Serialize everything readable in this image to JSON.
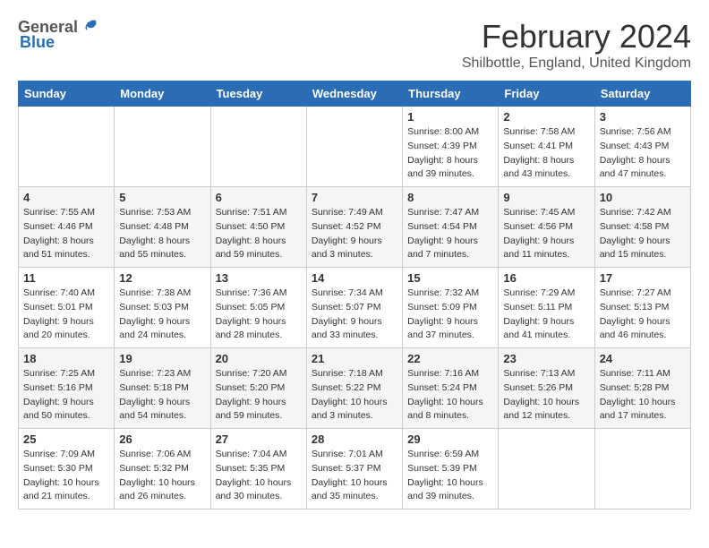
{
  "header": {
    "logo_general": "General",
    "logo_blue": "Blue",
    "month_year": "February 2024",
    "location": "Shilbottle, England, United Kingdom"
  },
  "weekdays": [
    "Sunday",
    "Monday",
    "Tuesday",
    "Wednesday",
    "Thursday",
    "Friday",
    "Saturday"
  ],
  "weeks": [
    [
      {
        "day": "",
        "info": ""
      },
      {
        "day": "",
        "info": ""
      },
      {
        "day": "",
        "info": ""
      },
      {
        "day": "",
        "info": ""
      },
      {
        "day": "1",
        "info": "Sunrise: 8:00 AM\nSunset: 4:39 PM\nDaylight: 8 hours\nand 39 minutes."
      },
      {
        "day": "2",
        "info": "Sunrise: 7:58 AM\nSunset: 4:41 PM\nDaylight: 8 hours\nand 43 minutes."
      },
      {
        "day": "3",
        "info": "Sunrise: 7:56 AM\nSunset: 4:43 PM\nDaylight: 8 hours\nand 47 minutes."
      }
    ],
    [
      {
        "day": "4",
        "info": "Sunrise: 7:55 AM\nSunset: 4:46 PM\nDaylight: 8 hours\nand 51 minutes."
      },
      {
        "day": "5",
        "info": "Sunrise: 7:53 AM\nSunset: 4:48 PM\nDaylight: 8 hours\nand 55 minutes."
      },
      {
        "day": "6",
        "info": "Sunrise: 7:51 AM\nSunset: 4:50 PM\nDaylight: 8 hours\nand 59 minutes."
      },
      {
        "day": "7",
        "info": "Sunrise: 7:49 AM\nSunset: 4:52 PM\nDaylight: 9 hours\nand 3 minutes."
      },
      {
        "day": "8",
        "info": "Sunrise: 7:47 AM\nSunset: 4:54 PM\nDaylight: 9 hours\nand 7 minutes."
      },
      {
        "day": "9",
        "info": "Sunrise: 7:45 AM\nSunset: 4:56 PM\nDaylight: 9 hours\nand 11 minutes."
      },
      {
        "day": "10",
        "info": "Sunrise: 7:42 AM\nSunset: 4:58 PM\nDaylight: 9 hours\nand 15 minutes."
      }
    ],
    [
      {
        "day": "11",
        "info": "Sunrise: 7:40 AM\nSunset: 5:01 PM\nDaylight: 9 hours\nand 20 minutes."
      },
      {
        "day": "12",
        "info": "Sunrise: 7:38 AM\nSunset: 5:03 PM\nDaylight: 9 hours\nand 24 minutes."
      },
      {
        "day": "13",
        "info": "Sunrise: 7:36 AM\nSunset: 5:05 PM\nDaylight: 9 hours\nand 28 minutes."
      },
      {
        "day": "14",
        "info": "Sunrise: 7:34 AM\nSunset: 5:07 PM\nDaylight: 9 hours\nand 33 minutes."
      },
      {
        "day": "15",
        "info": "Sunrise: 7:32 AM\nSunset: 5:09 PM\nDaylight: 9 hours\nand 37 minutes."
      },
      {
        "day": "16",
        "info": "Sunrise: 7:29 AM\nSunset: 5:11 PM\nDaylight: 9 hours\nand 41 minutes."
      },
      {
        "day": "17",
        "info": "Sunrise: 7:27 AM\nSunset: 5:13 PM\nDaylight: 9 hours\nand 46 minutes."
      }
    ],
    [
      {
        "day": "18",
        "info": "Sunrise: 7:25 AM\nSunset: 5:16 PM\nDaylight: 9 hours\nand 50 minutes."
      },
      {
        "day": "19",
        "info": "Sunrise: 7:23 AM\nSunset: 5:18 PM\nDaylight: 9 hours\nand 54 minutes."
      },
      {
        "day": "20",
        "info": "Sunrise: 7:20 AM\nSunset: 5:20 PM\nDaylight: 9 hours\nand 59 minutes."
      },
      {
        "day": "21",
        "info": "Sunrise: 7:18 AM\nSunset: 5:22 PM\nDaylight: 10 hours\nand 3 minutes."
      },
      {
        "day": "22",
        "info": "Sunrise: 7:16 AM\nSunset: 5:24 PM\nDaylight: 10 hours\nand 8 minutes."
      },
      {
        "day": "23",
        "info": "Sunrise: 7:13 AM\nSunset: 5:26 PM\nDaylight: 10 hours\nand 12 minutes."
      },
      {
        "day": "24",
        "info": "Sunrise: 7:11 AM\nSunset: 5:28 PM\nDaylight: 10 hours\nand 17 minutes."
      }
    ],
    [
      {
        "day": "25",
        "info": "Sunrise: 7:09 AM\nSunset: 5:30 PM\nDaylight: 10 hours\nand 21 minutes."
      },
      {
        "day": "26",
        "info": "Sunrise: 7:06 AM\nSunset: 5:32 PM\nDaylight: 10 hours\nand 26 minutes."
      },
      {
        "day": "27",
        "info": "Sunrise: 7:04 AM\nSunset: 5:35 PM\nDaylight: 10 hours\nand 30 minutes."
      },
      {
        "day": "28",
        "info": "Sunrise: 7:01 AM\nSunset: 5:37 PM\nDaylight: 10 hours\nand 35 minutes."
      },
      {
        "day": "29",
        "info": "Sunrise: 6:59 AM\nSunset: 5:39 PM\nDaylight: 10 hours\nand 39 minutes."
      },
      {
        "day": "",
        "info": ""
      },
      {
        "day": "",
        "info": ""
      }
    ]
  ]
}
